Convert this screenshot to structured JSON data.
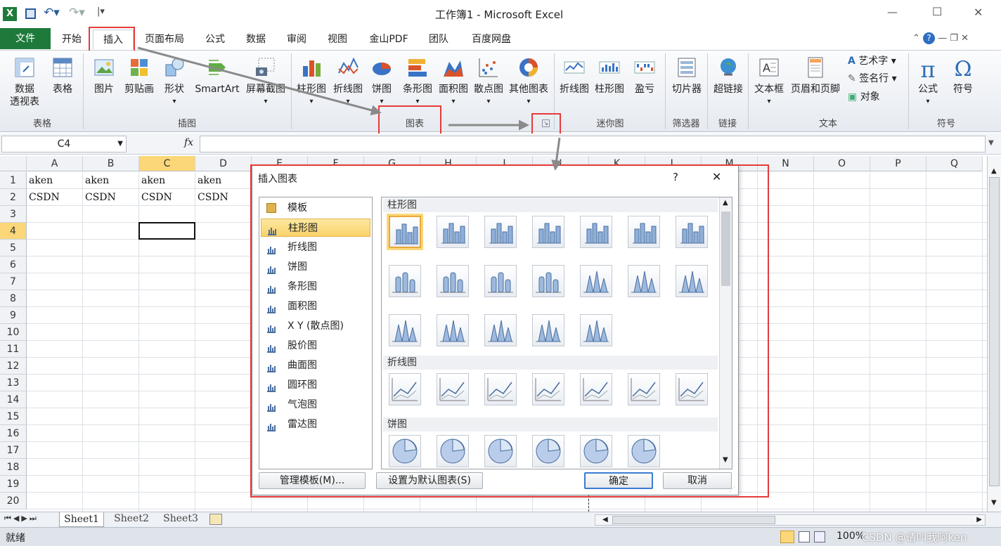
{
  "window": {
    "title": "工作簿1 - Microsoft Excel",
    "minimize": "—",
    "maximize": "☐",
    "close": "✕"
  },
  "ribbon_tabs": [
    {
      "label": "文件"
    },
    {
      "label": "开始"
    },
    {
      "label": "插入"
    },
    {
      "label": "页面布局"
    },
    {
      "label": "公式"
    },
    {
      "label": "数据"
    },
    {
      "label": "审阅"
    },
    {
      "label": "视图"
    },
    {
      "label": "金山PDF"
    },
    {
      "label": "团队"
    },
    {
      "label": "百度网盘"
    }
  ],
  "ribbon": {
    "pivot1": "数据",
    "pivot2": "透视表",
    "table": "表格",
    "picture": "图片",
    "clipart": "剪贴画",
    "shapes": "形状",
    "smartart": "SmartArt",
    "screenshot": "屏幕截图",
    "col": "柱形图",
    "line": "折线图",
    "pie": "饼图",
    "bar": "条形图",
    "area": "面积图",
    "scatter": "散点图",
    "other": "其他图表",
    "sp_line": "折线图",
    "sp_col": "柱形图",
    "sp_wl": "盈亏",
    "slicer": "切片器",
    "hyperlink": "超链接",
    "textbox": "文本框",
    "headerfooter": "页眉和页脚",
    "wordart": "艺术字",
    "signature": "签名行",
    "object": "对象",
    "equation": "公式",
    "symbol": "符号",
    "groups": {
      "tables": "表格",
      "illus": "插图",
      "charts": "图表",
      "sparklines": "迷你图",
      "filter": "筛选器",
      "links": "链接",
      "text": "文本",
      "symbols": "符号"
    }
  },
  "formula_bar": {
    "name_box": "C4",
    "fx": "fx"
  },
  "columns": [
    "A",
    "B",
    "C",
    "D",
    "E",
    "F",
    "G",
    "H",
    "I",
    "J",
    "K",
    "L",
    "M",
    "N",
    "O",
    "P",
    "Q"
  ],
  "rows": [
    "1",
    "2",
    "3",
    "4",
    "5",
    "6",
    "7",
    "8",
    "9",
    "10",
    "11",
    "12",
    "13",
    "14",
    "15",
    "16",
    "17",
    "18",
    "19",
    "20"
  ],
  "cells": [
    {
      "ref": "A1",
      "v": "aken"
    },
    {
      "ref": "B1",
      "v": "aken"
    },
    {
      "ref": "C1",
      "v": "aken"
    },
    {
      "ref": "D1",
      "v": "aken"
    },
    {
      "ref": "A2",
      "v": "CSDN"
    },
    {
      "ref": "B2",
      "v": "CSDN"
    },
    {
      "ref": "C2",
      "v": "CSDN"
    },
    {
      "ref": "D2",
      "v": "CSDN"
    }
  ],
  "sheets": [
    "Sheet1",
    "Sheet2",
    "Sheet3"
  ],
  "status": {
    "ready": "就绪",
    "zoom": "100%",
    "watermark": "CSDN @请叫我阿ken"
  },
  "dialog": {
    "title": "插入图表",
    "help": "?",
    "close": "✕",
    "categories": [
      "模板",
      "柱形图",
      "折线图",
      "饼图",
      "条形图",
      "面积图",
      "X Y (散点图)",
      "股价图",
      "曲面图",
      "圆环图",
      "气泡图",
      "雷达图"
    ],
    "selected_category": "柱形图",
    "section_col": "柱形图",
    "section_line": "折线图",
    "section_pie": "饼图",
    "btn_manage": "管理模板(M)...",
    "btn_default": "设置为默认图表(S)",
    "btn_ok": "确定",
    "btn_cancel": "取消"
  },
  "colors": {
    "accent": "#1e7a3a",
    "highlight": "#e53b3b",
    "selected": "#fbd77a"
  }
}
